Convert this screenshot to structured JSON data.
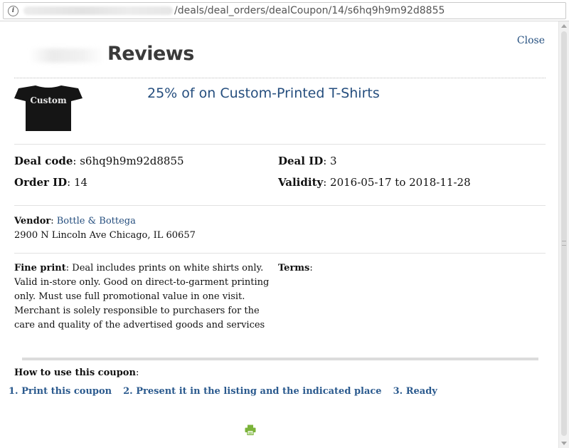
{
  "browser": {
    "url_path": "/deals/deal_orders/dealCoupon/14/s6hq9h9m92d8855"
  },
  "header": {
    "logo_text": "Reviews",
    "close_label": "Close"
  },
  "deal": {
    "title": "25% of on Custom-Printed T-Shirts",
    "image_text": "Custom",
    "deal_code_label": "Deal code",
    "deal_code": "s6hq9h9m92d8855",
    "deal_id_label": "Deal ID",
    "deal_id": "3",
    "order_id_label": "Order ID",
    "order_id": "14",
    "validity_label": "Validity",
    "validity": "2016-05-17 to 2018-11-28"
  },
  "vendor": {
    "label": "Vendor",
    "name": "Bottle & Bottega",
    "address": "2900 N Lincoln Ave Chicago, IL 60657"
  },
  "fine_print": {
    "label": "Fine print",
    "text": "Deal includes prints on white shirts only. Valid in-store only. Good on direct-to-garment printing only. Must use full promotional value in one visit. Merchant is solely responsible to purchasers for the care and quality of the advertised goods and services"
  },
  "terms": {
    "label": "Terms",
    "text": ""
  },
  "howto": {
    "title": "How to use this coupon",
    "steps": [
      "1. Print this coupon",
      "2. Present it in the listing and the indicated place",
      "3. Ready"
    ]
  },
  "colors": {
    "link": "#254e7e",
    "step": "#2b5a8e",
    "print_icon": "#7bb33a"
  },
  "icons": {
    "info": "info-icon",
    "print": "print-icon"
  }
}
